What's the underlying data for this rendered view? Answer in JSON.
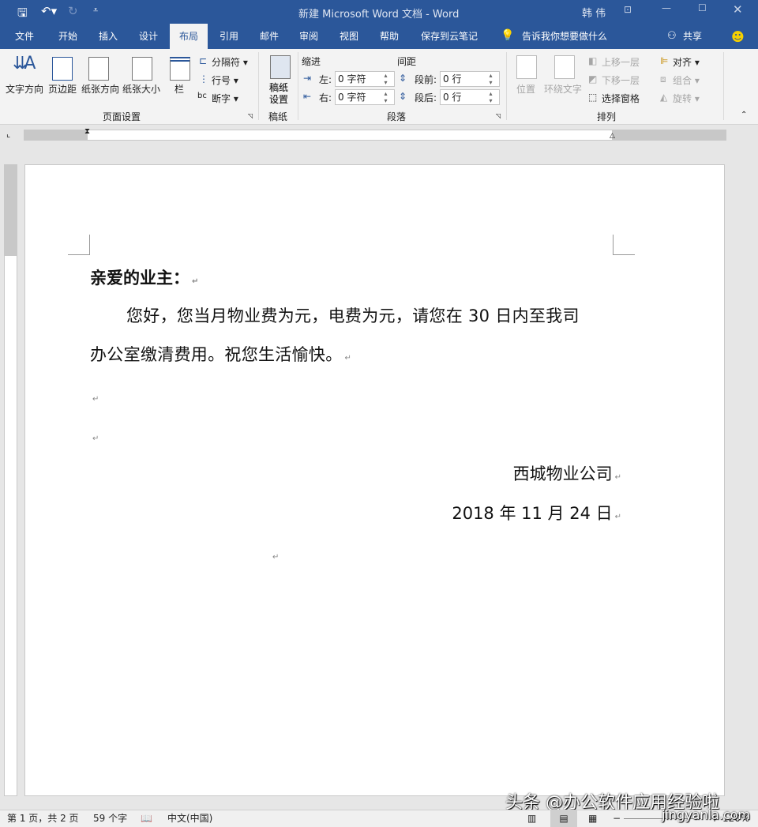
{
  "title_bar": {
    "title": "新建 Microsoft Word 文档  -  Word",
    "user": "韩 伟",
    "quick_access": [
      "save-icon",
      "undo-icon",
      "redo-icon",
      "customize-icon"
    ]
  },
  "tabs": [
    "文件",
    "开始",
    "插入",
    "设计",
    "布局",
    "引用",
    "邮件",
    "审阅",
    "视图",
    "帮助",
    "保存到云笔记"
  ],
  "active_tab": "布局",
  "tell_me": "告诉我你想要做什么",
  "share": "共享",
  "ribbon": {
    "page_setup": {
      "label": "页面设置",
      "buttons": [
        "文字方向",
        "页边距",
        "纸张方向",
        "纸张大小",
        "栏"
      ],
      "small": [
        "分隔符",
        "行号",
        "断字"
      ]
    },
    "manuscript": {
      "label": "稿纸",
      "button": "稿纸设置",
      "button_line1": "稿纸",
      "button_line2": "设置"
    },
    "paragraph": {
      "label": "段落",
      "indent_label": "缩进",
      "spacing_label": "间距",
      "left_label": "左:",
      "left_value": "0 字符",
      "right_label": "右:",
      "right_value": "0 字符",
      "before_label": "段前:",
      "before_value": "0 行",
      "after_label": "段后:",
      "after_value": "0 行"
    },
    "arrange": {
      "label": "排列",
      "position": "位置",
      "wrap": "环绕文字",
      "bring_forward": "上移一层",
      "send_backward": "下移一层",
      "selection_pane": "选择窗格",
      "align": "对齐",
      "group": "组合",
      "rotate": "旋转"
    }
  },
  "document": {
    "greeting": "亲爱的业主：",
    "line1": "您好，您当月物业费为元，电费为元，请您在 30 日内至我司",
    "line2": "办公室缴清费用。祝您生活愉快。",
    "company": "西城物业公司",
    "date": "2018 年 11 月 24 日",
    "para_mark": "↵"
  },
  "status": {
    "page": "第 1 页，共 2 页",
    "words": "59 个字",
    "language": "中文(中国)",
    "zoom": "120%"
  },
  "watermark": {
    "line1": "头条 @办公软件应用经验啦",
    "line2": "jingyanla.com"
  },
  "colors": {
    "accent": "#2b579a"
  }
}
